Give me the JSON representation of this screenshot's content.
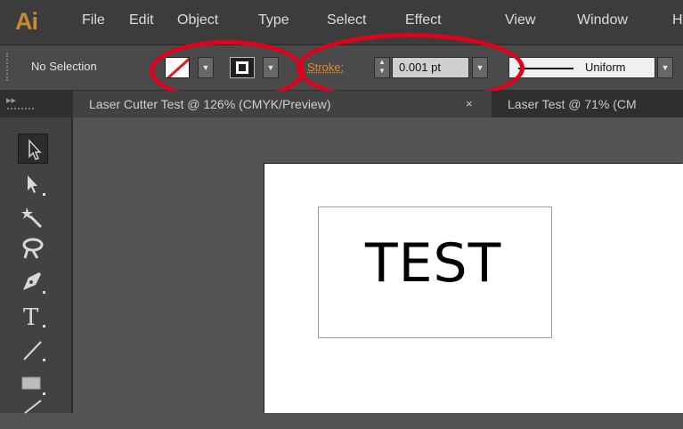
{
  "app": {
    "logo_text": "Ai",
    "menu": [
      "File",
      "Edit",
      "Object",
      "Type",
      "Select",
      "Effect",
      "View",
      "Window",
      "H"
    ]
  },
  "control_bar": {
    "selection_status": "No Selection",
    "fill_swatch": "none",
    "stroke_swatch": "stroke",
    "stroke_label": "Stroke:",
    "stroke_weight": "0.001 pt",
    "variable_width_profile": "Uniform",
    "colors": {
      "stroke_label": "#e38b25",
      "none_slash": "#e01b1b",
      "annotation": "#e3001b"
    }
  },
  "tabs": [
    {
      "label": "Laser Cutter Test @ 126% (CMYK/Preview)",
      "close": "×",
      "active": true
    },
    {
      "label": "Laser Test @ 71% (CM",
      "active": false
    }
  ],
  "tools": [
    {
      "name": "selection-tool",
      "active": true
    },
    {
      "name": "direct-selection-tool"
    },
    {
      "name": "magic-wand-tool"
    },
    {
      "name": "lasso-tool"
    },
    {
      "name": "pen-tool"
    },
    {
      "name": "type-tool",
      "glyph": "T"
    },
    {
      "name": "line-segment-tool"
    },
    {
      "name": "rectangle-tool"
    },
    {
      "name": "paintbrush-tool"
    }
  ],
  "artboard": {
    "text": "TEST"
  }
}
